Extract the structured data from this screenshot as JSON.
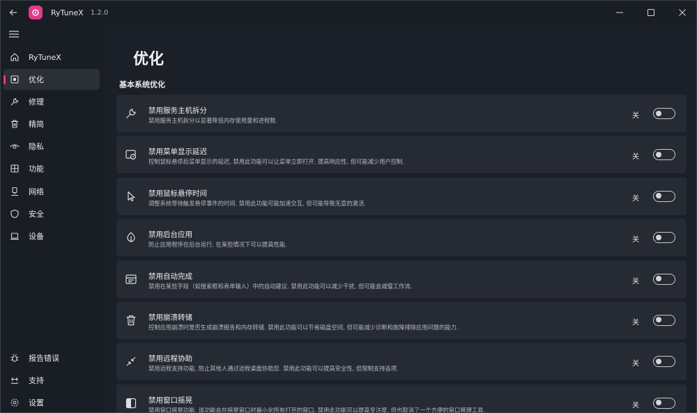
{
  "app": {
    "name": "RyTuneX",
    "version": "1.2.0",
    "accent": "#e2388a"
  },
  "sidebar": {
    "items": [
      {
        "label": "RyTuneX",
        "icon": "home-icon"
      },
      {
        "label": "优化",
        "icon": "optimize-icon",
        "active": true
      },
      {
        "label": "修理",
        "icon": "wrench-icon"
      },
      {
        "label": "精简",
        "icon": "trash-icon"
      },
      {
        "label": "隐私",
        "icon": "eye-icon"
      },
      {
        "label": "功能",
        "icon": "features-icon"
      },
      {
        "label": "网络",
        "icon": "network-icon"
      },
      {
        "label": "安全",
        "icon": "shield-icon"
      },
      {
        "label": "设备",
        "icon": "laptop-icon"
      }
    ],
    "bottom_items": [
      {
        "label": "报告错误",
        "icon": "bug-icon"
      },
      {
        "label": "支持",
        "icon": "support-icon"
      },
      {
        "label": "设置",
        "icon": "gear-icon"
      }
    ]
  },
  "main": {
    "title": "优化",
    "section_title": "基本系统优化",
    "cards": [
      {
        "icon": "wrench-icon",
        "title": "禁用服务主机拆分",
        "desc": "禁用服务主机拆分以显著降低内存使用量和进程数.",
        "state": "关"
      },
      {
        "icon": "menu-delay-icon",
        "title": "禁用菜单显示延迟",
        "desc": "控制鼠标悬停后菜单显示的延迟, 禁用此功能可以让菜单立即打开, 提高响应性, 但可能减少用户控制.",
        "state": "关"
      },
      {
        "icon": "cursor-icon",
        "title": "禁用鼠标悬停时间",
        "desc": "调整系统等待触发悬停事件的时间. 禁用此功能可能加速交互, 但可能导致无意的激活.",
        "state": "关"
      },
      {
        "icon": "leaf-icon",
        "title": "禁用后台应用",
        "desc": "防止应用程序在后台运行, 在某些情况下可以提高性能.",
        "state": "关"
      },
      {
        "icon": "autocomplete-icon",
        "title": "禁用自动完成",
        "desc": "禁用在某些字段（如搜索框和表单输入）中的自动建议. 禁用此功能可以减少干扰, 但可能会减慢工作流.",
        "state": "关"
      },
      {
        "icon": "trash-icon",
        "title": "禁用崩溃转储",
        "desc": "控制应用崩溃时是否生成崩溃报告和内存转储. 禁用此功能可以节省磁盘空间, 但可能减少诊断和故障排除应用问题的能力.",
        "state": "关"
      },
      {
        "icon": "remote-icon",
        "title": "禁用远程协助",
        "desc": "禁用远程支持功能, 防止其他人通过远程桌面协助您. 禁用此功能可以提高安全性, 但限制支持选项.",
        "state": "关"
      },
      {
        "icon": "contrast-icon",
        "title": "禁用窗口摇晃",
        "desc": "禁用窗口摇晃功能, 该功能会在摇晃窗口时最小化所有打开的窗口. 禁用此功能可以提高专注度, 但也取消了一个方便的窗口管理工具.",
        "state": "关"
      }
    ]
  }
}
